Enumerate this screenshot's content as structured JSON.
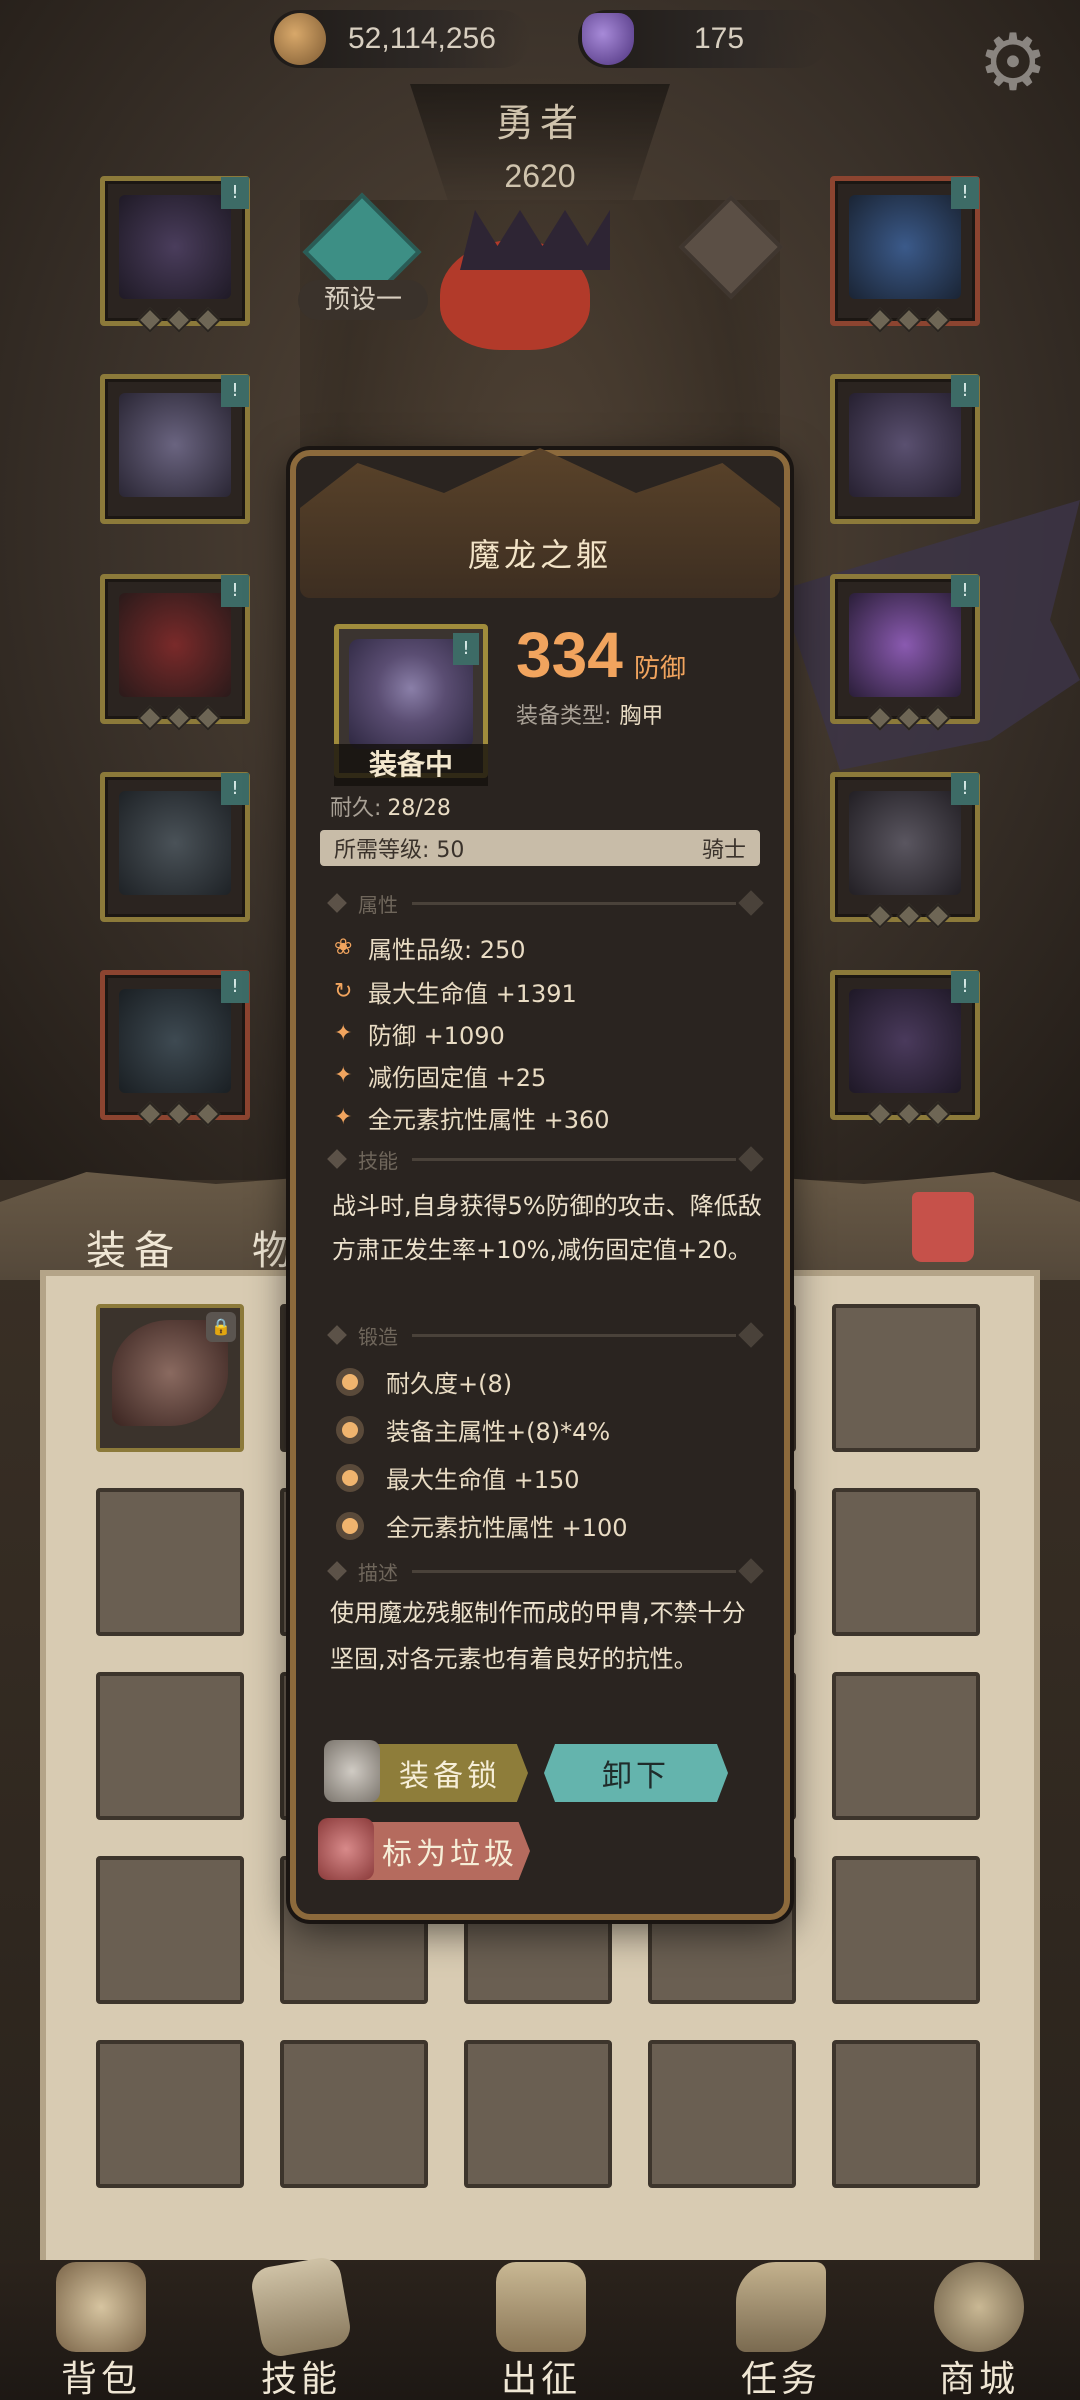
{
  "currency": {
    "gold": "52,114,256",
    "gems": "175",
    "gold_icon": "gold-coin-icon",
    "gem_icon": "purple-crystal-icon"
  },
  "hero": {
    "name": "勇者",
    "power": "2620",
    "preset_label": "预设一"
  },
  "tabs": {
    "equipment": "装备",
    "items": "物品"
  },
  "popup": {
    "title": "魔龙之躯",
    "value": "334",
    "value_unit": "防御",
    "equip_type_label": "装备类型:",
    "equip_type": "胸甲",
    "equipped_label": "装备中",
    "durability_label": "耐久:",
    "durability": "28/28",
    "required_level_label": "所需等级: 50",
    "class": "骑士",
    "section_attributes": "属性",
    "attr_grade": "属性品级: 250",
    "attributes": [
      {
        "icon": "✦",
        "text": "最大生命值 +1391",
        "icon_name": "refresh-icon"
      },
      {
        "icon": "✦",
        "text": "防御 +1090",
        "icon_name": "sparkle-icon"
      },
      {
        "icon": "✦",
        "text": "减伤固定值 +25",
        "icon_name": "sparkle-icon"
      },
      {
        "icon": "✦",
        "text": "全元素抗性属性 +360",
        "icon_name": "sparkle-icon"
      }
    ],
    "section_skill": "技能",
    "skill": "战斗时,自身获得5%防御的攻击、降低敌方肃正发生率+10%,减伤固定值+20。",
    "section_forge": "锻造",
    "forge": [
      "耐久度+(8)",
      "装备主属性+(8)*4%",
      "最大生命值 +150",
      "全元素抗性属性 +100"
    ],
    "section_desc": "描述",
    "description": "使用魔龙残躯制作而成的甲胄,不禁十分坚固,对各元素也有着良好的抗性。",
    "buttons": {
      "lock": "装备锁",
      "unequip": "卸下",
      "junk": "标为垃圾"
    }
  },
  "nav": {
    "items": [
      {
        "label": "背包",
        "icon": "backpack-icon"
      },
      {
        "label": "技能",
        "icon": "skill-card-icon"
      },
      {
        "label": "出征",
        "icon": "map-sword-icon"
      },
      {
        "label": "任务",
        "icon": "scroll-icon"
      },
      {
        "label": "商城",
        "icon": "shop-icon"
      }
    ]
  },
  "colors": {
    "accent_orange": "#f1a45e",
    "teal": "#64b4ad",
    "gold_frame": "#8c7a3a"
  }
}
